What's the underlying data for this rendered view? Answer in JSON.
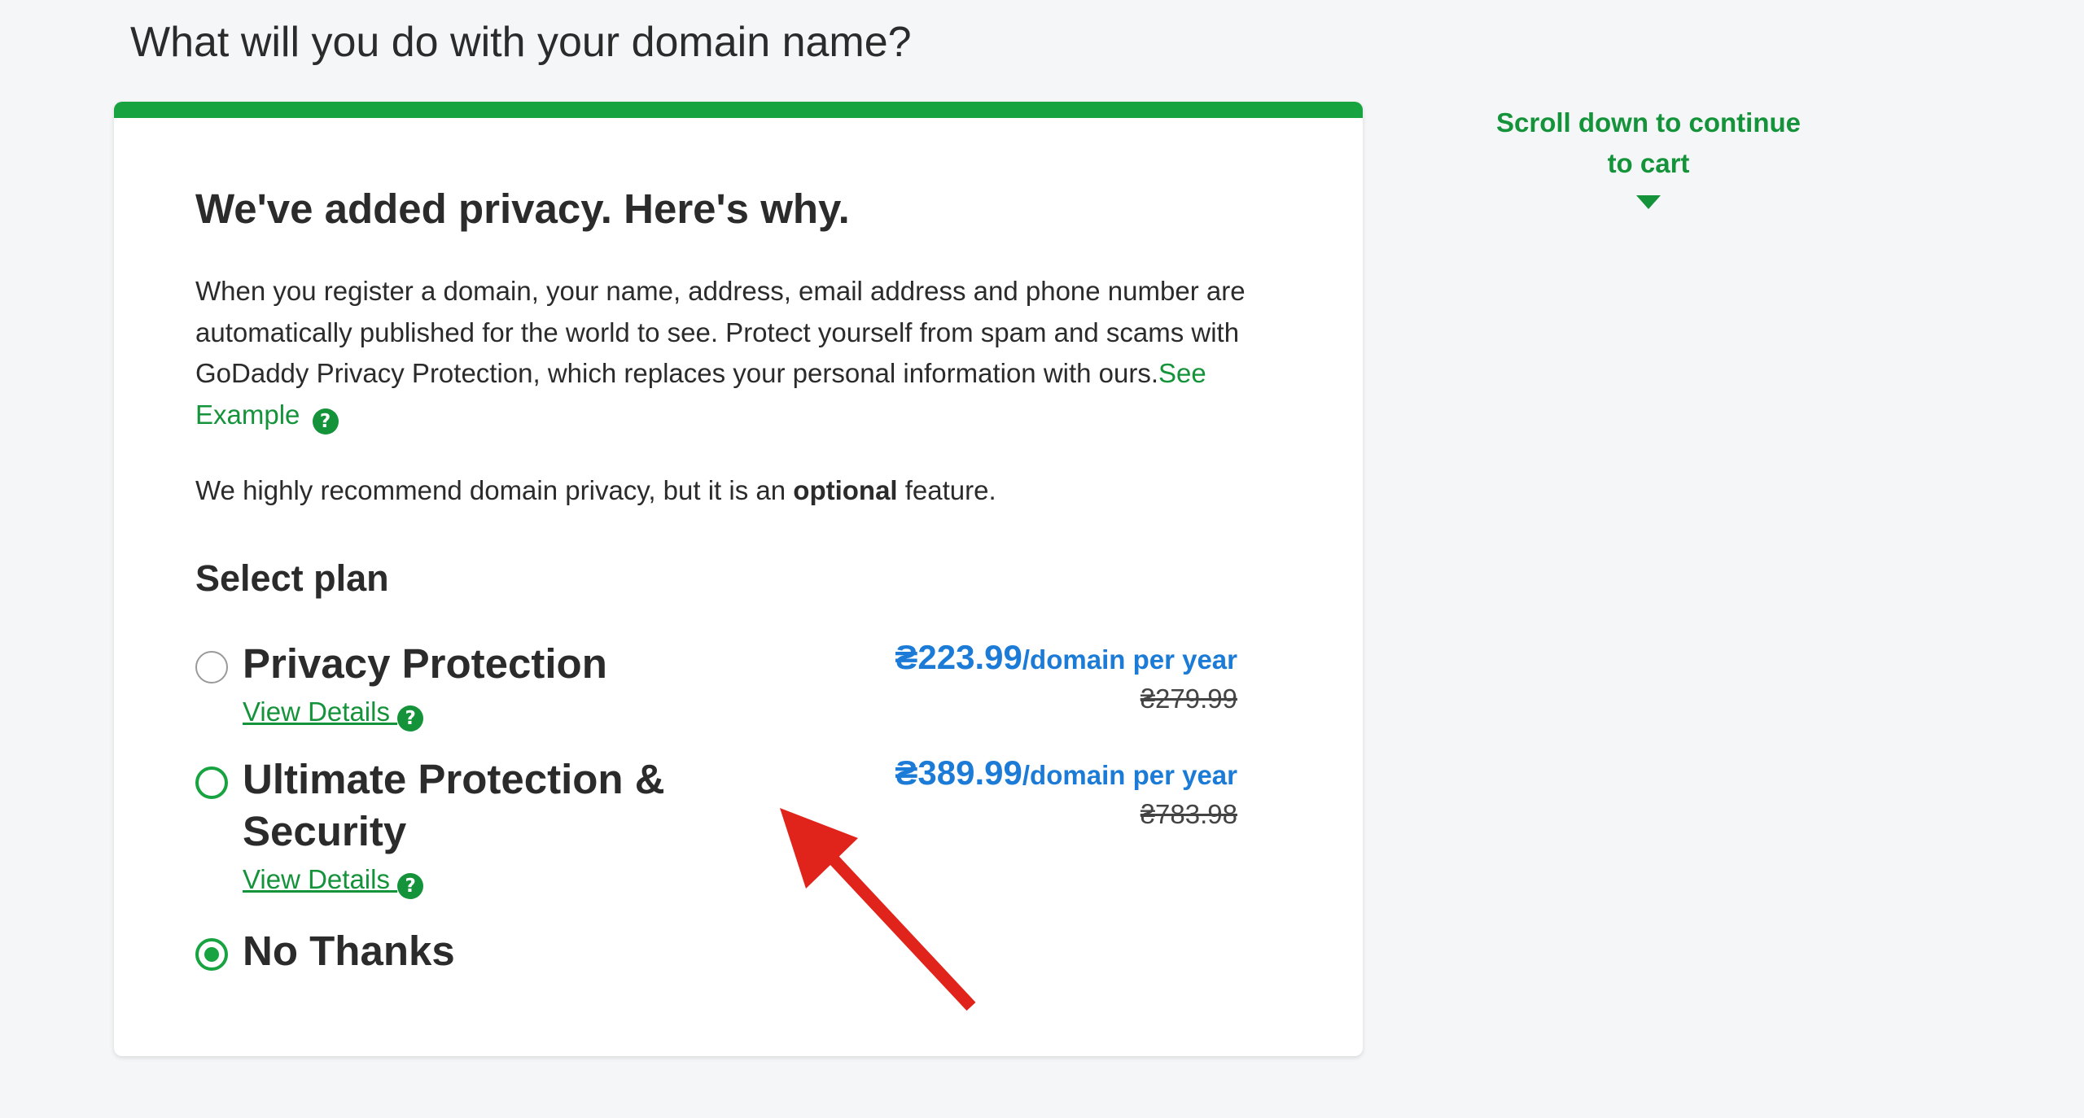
{
  "page": {
    "title": "What will you do with your domain name?"
  },
  "card": {
    "heading": "We've added privacy. Here's why.",
    "description": "When you register a domain, your name, address, email address and phone number are automatically published for the world to see. Protect yourself from spam and scams with GoDaddy Privacy Protection, which replaces your personal information with ours.",
    "see_example_link": "See Example",
    "recommend_prefix": "We highly recommend domain privacy, but it is an ",
    "recommend_bold": "optional",
    "recommend_suffix": " feature.",
    "select_plan_label": "Select plan"
  },
  "plans": [
    {
      "name": "Privacy Protection",
      "view_details": "View Details",
      "price": "₴223.99",
      "price_unit": "/domain per year",
      "old_price": "₴279.99",
      "selected": false
    },
    {
      "name": "Ultimate Protection & Security",
      "view_details": "View Details",
      "price": "₴389.99",
      "price_unit": "/domain per year",
      "old_price": "₴783.98",
      "selected": false
    },
    {
      "name": "No Thanks",
      "selected": true
    }
  ],
  "scroll_hint": {
    "line1": "Scroll down to continue",
    "line2": "to cart"
  },
  "colors": {
    "accent_green": "#17a340",
    "link_green": "#15933a",
    "price_blue": "#1c7bd6",
    "annotation_red": "#e0231b"
  },
  "icons": {
    "help": "help-question-icon",
    "scroll": "caret-down-icon",
    "annotation": "red-arrow-annotation"
  }
}
